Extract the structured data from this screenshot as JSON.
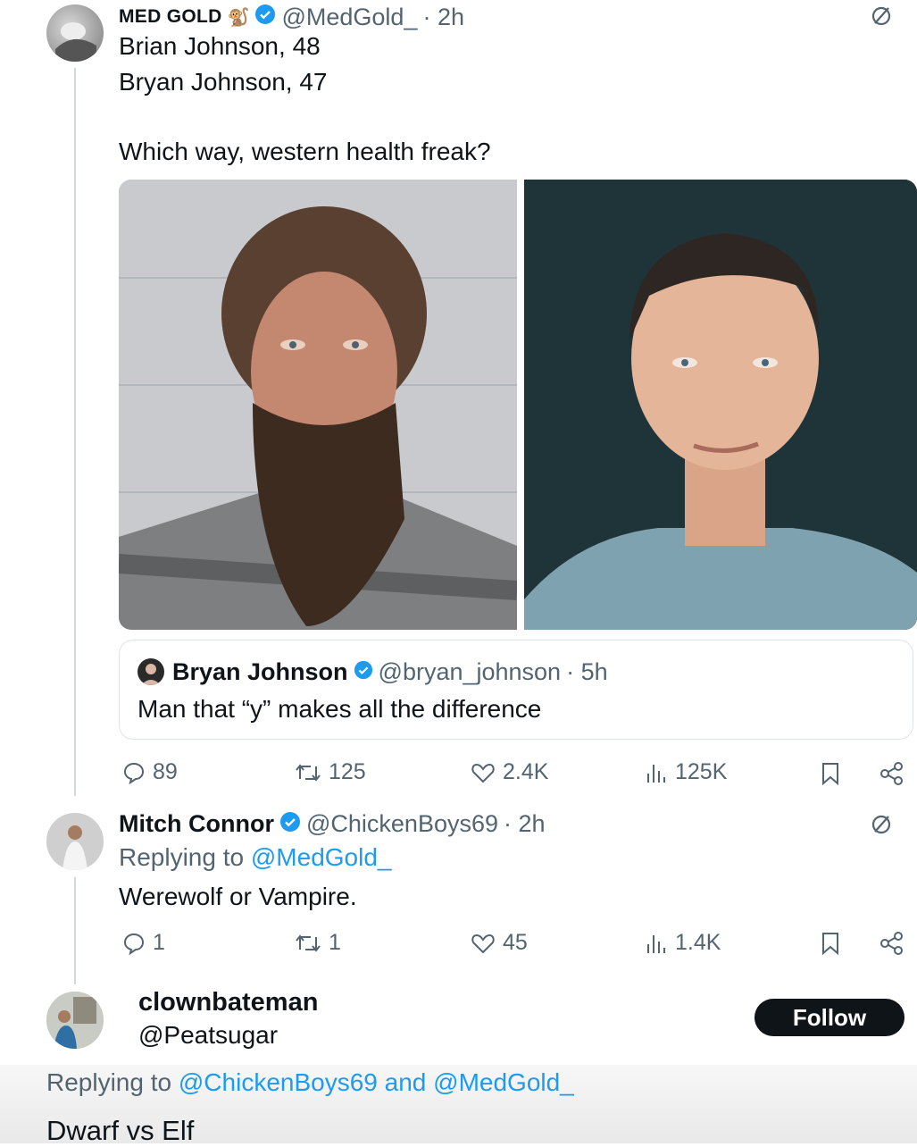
{
  "post": {
    "author_name": "MED GOLD",
    "author_handle": "@MedGold_",
    "time": "· 2h",
    "lines": [
      "Brian Johnson, 48",
      "Bryan Johnson, 47",
      "Which way, western health freak?"
    ],
    "quote": {
      "author_name": "Bryan Johnson",
      "author_handle": "@bryan_johnson",
      "time": "· 5h",
      "text": "Man that “y” makes all the difference"
    },
    "metrics": {
      "replies": "89",
      "reposts": "125",
      "likes": "2.4K",
      "views": "125K"
    }
  },
  "reply1": {
    "author_name": "Mitch Connor",
    "author_handle": "@ChickenBoys69",
    "time": "· 2h",
    "replying_prefix": "Replying to",
    "replying_to": "@MedGold_",
    "text": "Werewolf or Vampire.",
    "metrics": {
      "replies": "1",
      "reposts": "1",
      "likes": "45",
      "views": "1.4K"
    }
  },
  "reply2": {
    "author_name": "clownbateman",
    "author_handle": "@Peatsugar",
    "follow_label": "Follow",
    "replying_prefix": "Replying to",
    "replying_to_1": "@ChickenBoys69",
    "and_word": "and",
    "replying_to_2": "@MedGold_",
    "text": "Dwarf vs Elf"
  },
  "colors": {
    "accent": "#1d9bf0",
    "text": "#0f1419",
    "muted": "#536471",
    "verified": "#1d9bf0",
    "follow_bg": "#0f1419"
  },
  "icons": [
    "grok-icon",
    "verified-icon",
    "reply-icon",
    "repost-icon",
    "like-icon",
    "views-icon",
    "bookmark-icon",
    "share-icon"
  ]
}
